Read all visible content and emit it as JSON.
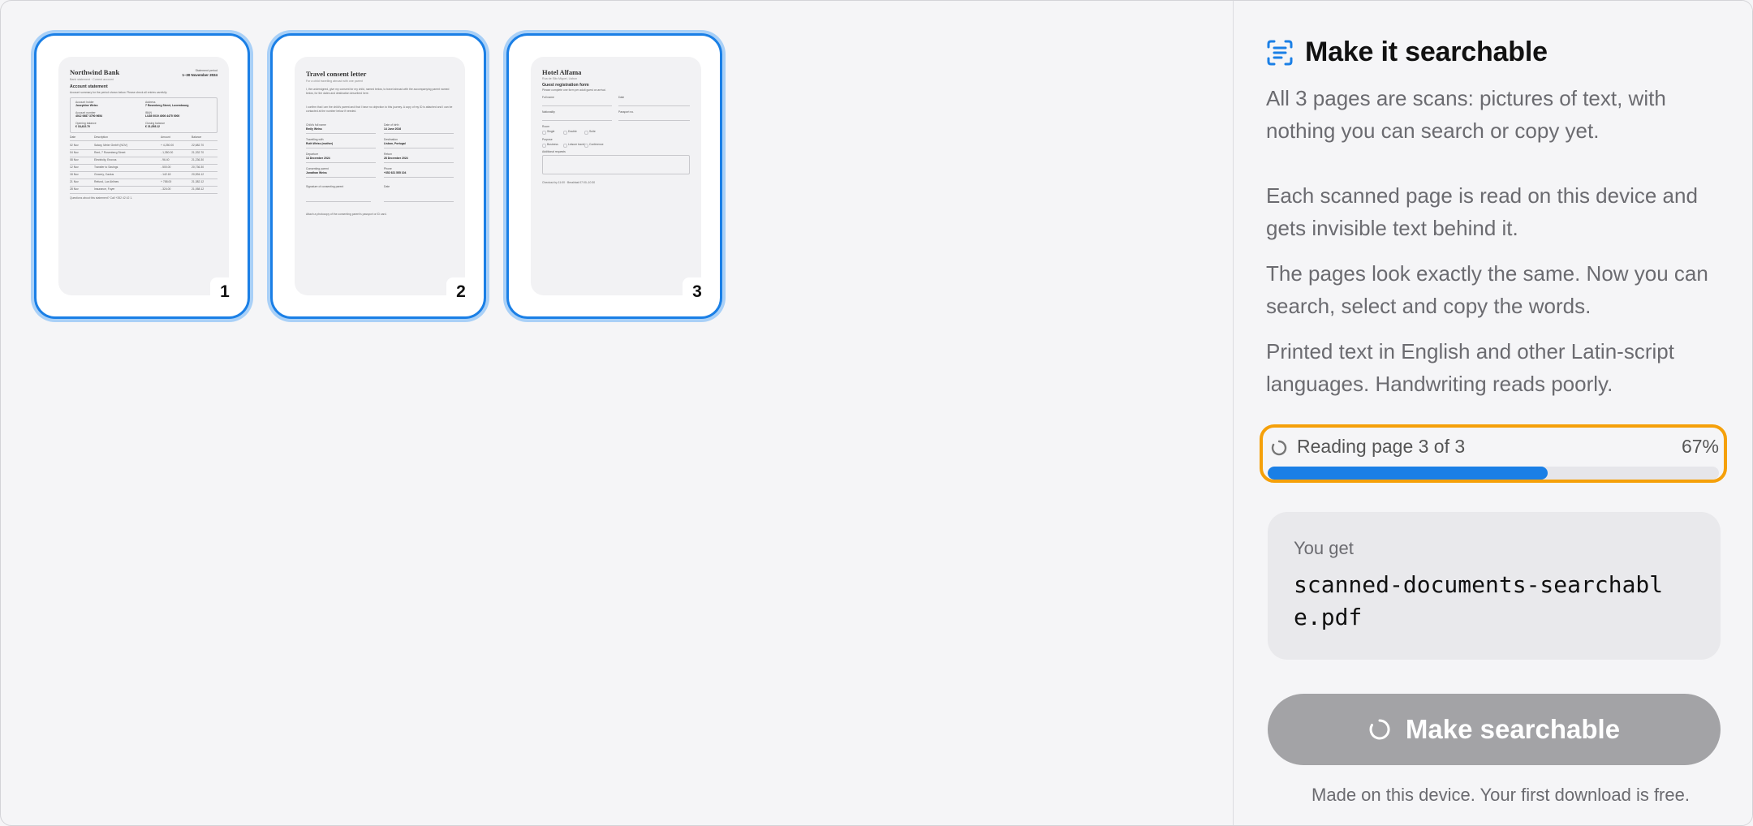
{
  "pages": [
    {
      "number": "1",
      "title": "Northwind Bank",
      "subtitle": "Bank statement · Current account",
      "right_lines": [
        "Statement period",
        "1–30 November 2024"
      ],
      "heading": "Account statement",
      "intro": "Account summary for the period shown below. Please check all entries carefully.",
      "fields": [
        [
          "Account holder",
          "Josephine Weiss"
        ],
        [
          "Address",
          "7 Rosenberg Street, Luxembourg"
        ],
        [
          "Account number",
          "4012 0687 3790 9654"
        ],
        [
          "IBAN",
          "LU28 0019 4006 4475 0000"
        ],
        [
          "Opening balance",
          "€ 18,432.70"
        ],
        [
          "Closing balance",
          "€ 21,058.12"
        ]
      ],
      "table_header": [
        "Date",
        "Description",
        "Amount",
        "Balance"
      ],
      "rows": [
        [
          "02 Nov",
          "Salary, Meier GmbH (NOV)",
          "+ 4,250.00",
          "22,682.70"
        ],
        [
          "04 Nov",
          "Rent, 7 Rosenberg Street",
          "- 1,350.00",
          "21,332.70"
        ],
        [
          "08 Nov",
          "Electricity, Enovos",
          "- 96.40",
          "21,236.30"
        ],
        [
          "12 Nov",
          "Transfer to Savings",
          "- 500.00",
          "20,736.30"
        ],
        [
          "18 Nov",
          "Grocery, Cactus",
          "- 142.18",
          "20,594.12"
        ],
        [
          "21 Nov",
          "Refund, Lux Airlines",
          "+ 788.00",
          "21,382.12"
        ],
        [
          "28 Nov",
          "Insurance, Foyer",
          "- 324.00",
          "21,058.12"
        ]
      ],
      "footer": "Questions about this statement? Call +352 42 42 1."
    },
    {
      "number": "2",
      "title": "Travel consent letter",
      "subtitle": "For a child travelling abroad with one parent",
      "para1": "I, the undersigned, give my consent for my child, named below, to travel abroad with the accompanying parent named below, for the dates and destination described here.",
      "para2": "I confirm that I am the child's parent and that I have no objection to this journey. A copy of my ID is attached and I can be contacted at the number below if needed.",
      "fields": [
        [
          "Child's full name",
          "Emily Weiss"
        ],
        [
          "Date of birth",
          "14 June 2016"
        ],
        [
          "Travelling with",
          "Ruth Weiss (mother)"
        ],
        [
          "Destination",
          "Lisbon, Portugal"
        ],
        [
          "Departure",
          "14 December 2024"
        ],
        [
          "Return",
          "28 December 2024"
        ],
        [
          "Consenting parent",
          "Jonathan Weiss"
        ],
        [
          "Phone",
          "+352 621 555 104"
        ]
      ],
      "signature_label": "Signature of consenting parent",
      "date_label": "Date",
      "footer": "Attach a photocopy of the consenting parent's passport or ID card."
    },
    {
      "number": "3",
      "title": "Hotel Alfama",
      "subtitle": "Rua de São Miguel, Lisbon",
      "heading": "Guest registration form",
      "intro": "Please complete one form per adult guest on arrival.",
      "fields": [
        [
          "Full name",
          "Date"
        ],
        [
          "Nationality",
          "Passport no."
        ]
      ],
      "room_label": "Room",
      "room_options": [
        "Single",
        "Double",
        "Suite"
      ],
      "purpose_label": "Purpose",
      "purpose_options": [
        "Business",
        "Leisure travel",
        "Conference"
      ],
      "notes_label": "Additional requests",
      "footer": "Checkout by 11:00 · Breakfast 07:00–10:30"
    }
  ],
  "panel": {
    "title": "Make it searchable",
    "title_icon": "text-scan-icon",
    "intro": "All 3 pages are scans: pictures of text, with nothing you can search or copy yet.",
    "para1": "Each scanned page is read on this device and gets invisible text behind it.",
    "para2": "The pages look exactly the same. Now you can search, select and copy the words.",
    "para3": "Printed text in English and other Latin-script languages. Handwriting reads poorly.",
    "progress": {
      "label": "Reading page 3 of 3",
      "percent_label": "67%",
      "value": 0.62
    },
    "output": {
      "caption": "You get",
      "filename": "scanned-documents-searchable.pdf"
    },
    "button_label": "Make searchable",
    "footnote": "Made on this device. Your first download is free."
  },
  "colors": {
    "accent": "#1a7fe6",
    "highlight": "#f5a00a",
    "button_disabled": "#a3a3a6"
  }
}
